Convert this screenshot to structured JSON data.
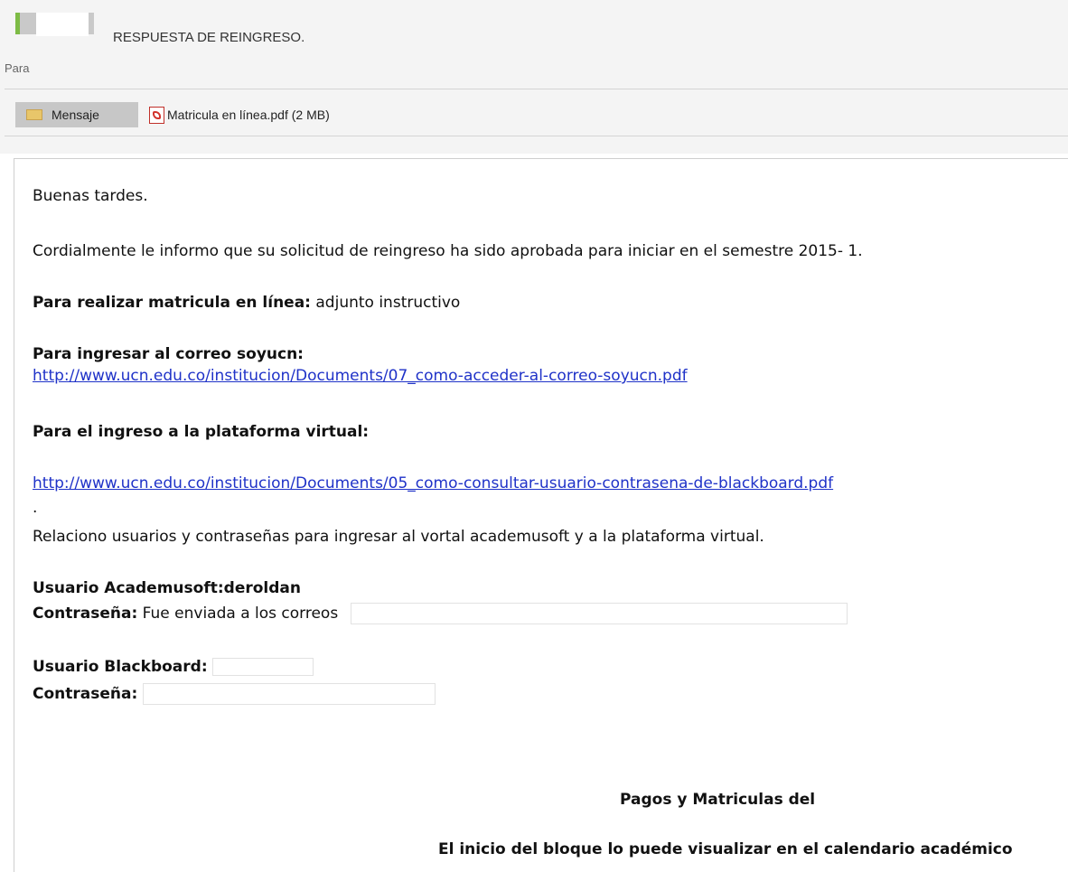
{
  "header": {
    "subject": "RESPUESTA DE REINGRESO.",
    "to_label": "Para",
    "message_tab": "Mensaje",
    "attachment": "Matricula en línea.pdf (2 MB)"
  },
  "body": {
    "greeting": "Buenas tardes.",
    "intro": "Cordialmente le informo que su solicitud de reingreso ha sido aprobada para iniciar en el semestre 2015- 1.",
    "matricula_label": "Para realizar matricula en línea:",
    "matricula_text": " adjunto instructivo",
    "correo_label": "Para ingresar al correo soyucn:",
    "correo_link": "http://www.ucn.edu.co/institucion/Documents/07_como-acceder-al-correo-soyucn.pdf",
    "plataforma_label": "Para el ingreso a la  plataforma virtual:",
    "plataforma_link": "http://www.ucn.edu.co/institucion/Documents/05_como-consultar-usuario-contrasena-de-blackboard.pdf",
    "dot": ".",
    "relaciono": "Relaciono usuarios y contraseñas para ingresar al vortal academusoft y a la plataforma virtual.",
    "usuario_academusoft": "Usuario Academusoft:deroldan",
    "contrasena_label": "Contraseña:",
    "contrasena_text": " Fue enviada a los correos",
    "usuario_blackboard": "Usuario Blackboard:",
    "contrasena2_label": "Contraseña:",
    "pagos": "Pagos y Matriculas del",
    "inicio": "El inicio del bloque lo puede visualizar en el calendario académico"
  },
  "icons": {
    "sender": "sender-color-icon",
    "message": "envelope-icon",
    "attachment": "pdf-icon"
  }
}
